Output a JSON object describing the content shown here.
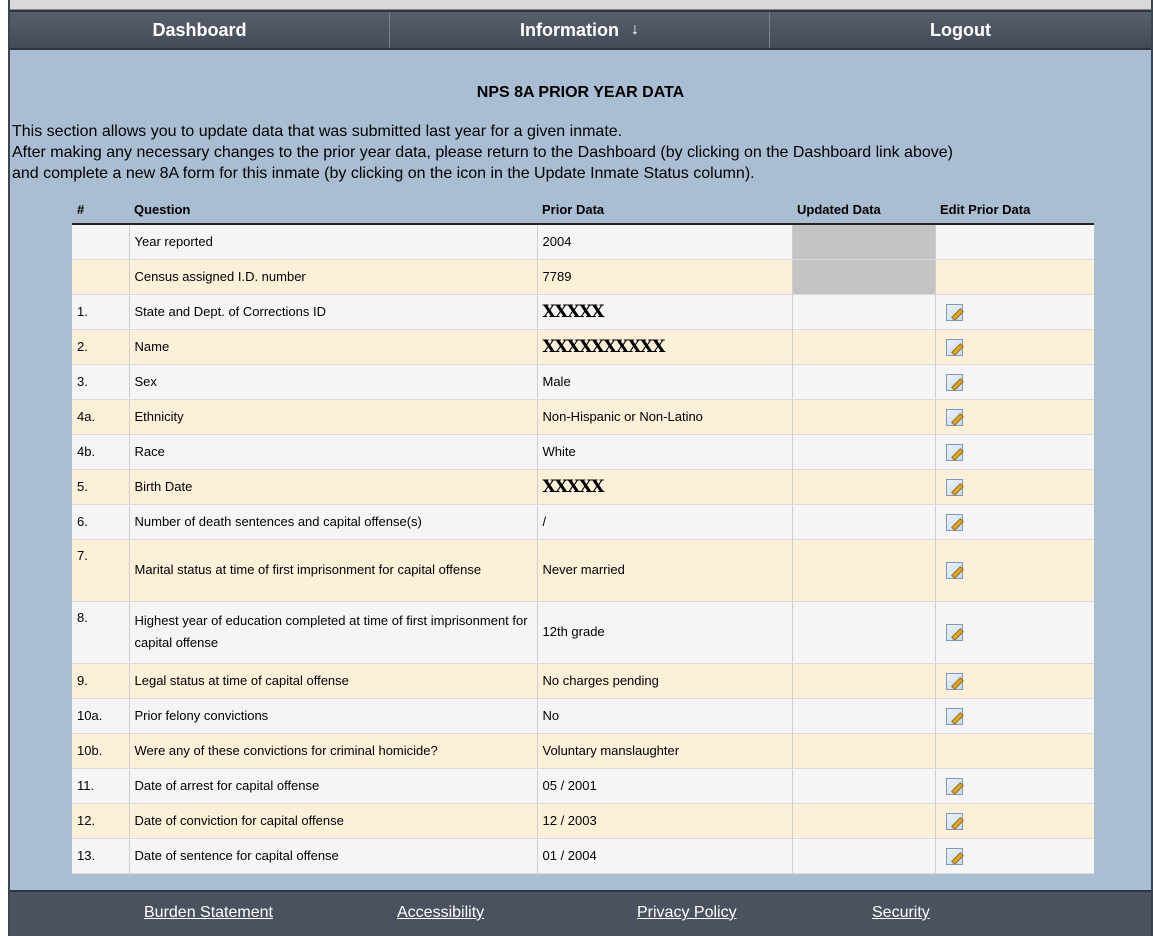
{
  "nav": {
    "dashboard": "Dashboard",
    "information": "Information",
    "information_arrow": "↓",
    "logout": "Logout"
  },
  "page": {
    "title": "NPS 8A PRIOR YEAR DATA",
    "intro_lines": [
      "This section allows you to update data that was submitted last year for a given inmate.",
      "After making any necessary changes to the prior year data, please return to the Dashboard (by clicking on the Dashboard link above)",
      "and complete a new 8A form for this inmate (by clicking on the icon in the Update Inmate Status column)."
    ]
  },
  "table": {
    "headers": {
      "num": "#",
      "question": "Question",
      "prior": "Prior Data",
      "updated": "Updated Data",
      "edit": "Edit Prior Data"
    },
    "rows": [
      {
        "num": "",
        "question": "Year reported",
        "prior": "2004",
        "shaded": true,
        "edit": false
      },
      {
        "num": "",
        "question": "Census assigned I.D. number",
        "prior": "7789",
        "shaded": true,
        "edit": false
      },
      {
        "num": "1.",
        "question": "State and Dept. of Corrections ID",
        "prior": "XXXXX",
        "redacted": true,
        "edit": true
      },
      {
        "num": "2.",
        "question": "Name",
        "prior": "XXXXXXXXXX",
        "redacted": true,
        "edit": true
      },
      {
        "num": "3.",
        "question": "Sex",
        "prior": "Male",
        "edit": true
      },
      {
        "num": "4a.",
        "question": "Ethnicity",
        "prior": "Non-Hispanic or Non-Latino",
        "edit": true
      },
      {
        "num": "4b.",
        "question": "Race",
        "prior": "White",
        "edit": true
      },
      {
        "num": "5.",
        "question": "Birth Date",
        "prior": "XXXXX",
        "redacted": true,
        "edit": true
      },
      {
        "num": "6.",
        "question": "Number of death sentences and capital offense(s)",
        "prior": "/",
        "edit": true
      },
      {
        "num": "7.",
        "question": "Marital status at time of first imprisonment for capital offense",
        "prior": "Never married",
        "edit": true,
        "tall": true
      },
      {
        "num": "8.",
        "question": "Highest year of education completed at time of first imprisonment for capital offense",
        "prior": "12th grade",
        "edit": true,
        "tall": true
      },
      {
        "num": "9.",
        "question": "Legal status at time of capital offense",
        "prior": "No charges pending",
        "edit": true
      },
      {
        "num": "10a.",
        "question": "Prior felony convictions",
        "prior": "No",
        "edit": true
      },
      {
        "num": "10b.",
        "question": "Were any of these convictions for criminal homicide?",
        "prior": "Voluntary manslaughter",
        "edit": false
      },
      {
        "num": "11.",
        "question": "Date of arrest for capital offense",
        "prior": "05 / 2001",
        "edit": true
      },
      {
        "num": "12.",
        "question": "Date of conviction for capital offense",
        "prior": "12 / 2003",
        "edit": true
      },
      {
        "num": "13.",
        "question": "Date of sentence for capital offense",
        "prior": "01 / 2004",
        "edit": true
      }
    ]
  },
  "footer": {
    "burden": "Burden Statement",
    "accessibility": "Accessibility",
    "privacy": "Privacy Policy",
    "security": "Security"
  },
  "icons": {
    "edit": "edit-pencil-icon"
  }
}
